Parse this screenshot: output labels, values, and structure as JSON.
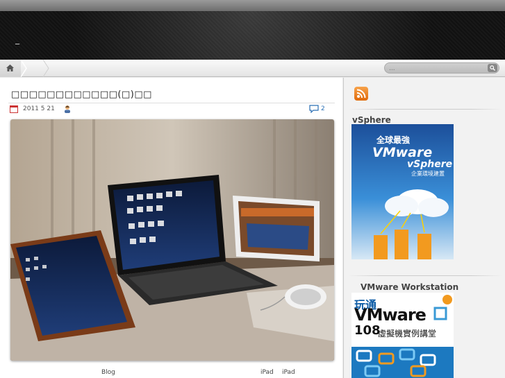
{
  "header": {
    "site_title": "_"
  },
  "nav": {
    "search_placeholder": "..."
  },
  "post": {
    "title": "□□□□□□□□□□□□(□)□□",
    "date": "2011 5 21",
    "comment_count": "2"
  },
  "tags": {
    "blog": "Blog",
    "ipad1": "iPad",
    "ipad2": "iPad"
  },
  "sidebar": {
    "widget1_title": "vSphere",
    "widget2_title": "VMware Workstation",
    "book1": {
      "line1": "全球最強",
      "line2": "VMware",
      "line3": "vSphere",
      "line4": "企業環境建置"
    },
    "book2": {
      "line1": "玩通",
      "line2": "VMware",
      "line3": "108",
      "line4": "虛擬機實例講堂"
    }
  },
  "colors": {
    "accent": "#2a6fb5",
    "header_bg": "#1a1a1a",
    "rss": "#e06a0b"
  }
}
